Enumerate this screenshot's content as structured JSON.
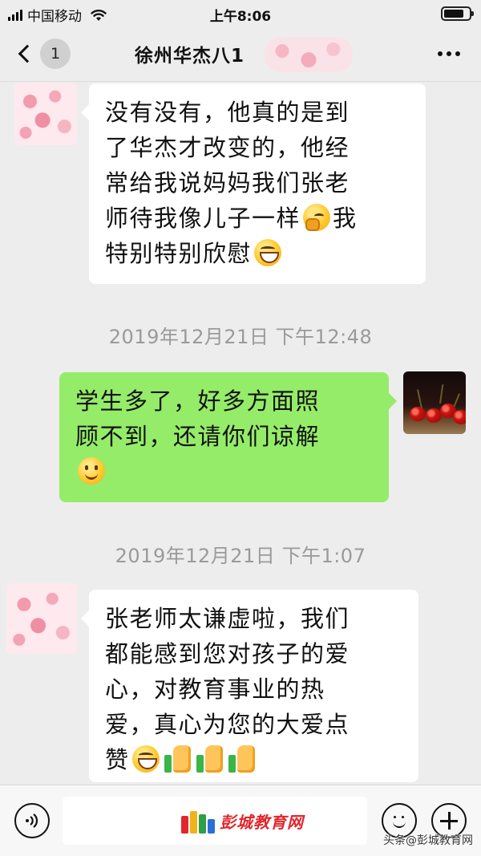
{
  "status_bar": {
    "carrier": "中国移动",
    "time": "上午8:06",
    "battery_level": 0.8
  },
  "nav": {
    "back_badge": "1",
    "title": "徐州华杰八1"
  },
  "messages": [
    {
      "side": "in",
      "lines": [
        "没有没有，他真的是到",
        "了华杰才改变的，他经",
        "常给我说妈妈我们张老",
        "师待我像儿子一样",
        "我",
        "特别特别欣慰"
      ]
    },
    {
      "timestamp": "2019年12月21日 下午12:48"
    },
    {
      "side": "out",
      "lines": [
        "学生多了，好多方面照",
        "顾不到，还请你们谅解"
      ]
    },
    {
      "timestamp": "2019年12月21日 下午1:07"
    },
    {
      "side": "in",
      "lines": [
        "张老师太谦虚啦，我们",
        "都能感到您对孩子的爱",
        "心，对教育事业的热",
        "爱，真心为您的大爱点",
        "赞"
      ]
    }
  ],
  "emoji_names": [
    "thinking-face-icon",
    "grinning-face-icon",
    "smiling-face-icon",
    "thumbs-up-icon"
  ],
  "input_bar": {
    "watermark": "彭城教育网"
  },
  "credit": "头条@彭城教育网",
  "colors": {
    "background": "#ededed",
    "incoming_bubble": "#ffffff",
    "outgoing_bubble": "#95ec69",
    "timestamp_text": "#9a9a9a",
    "watermark_text": "#e3262c"
  }
}
